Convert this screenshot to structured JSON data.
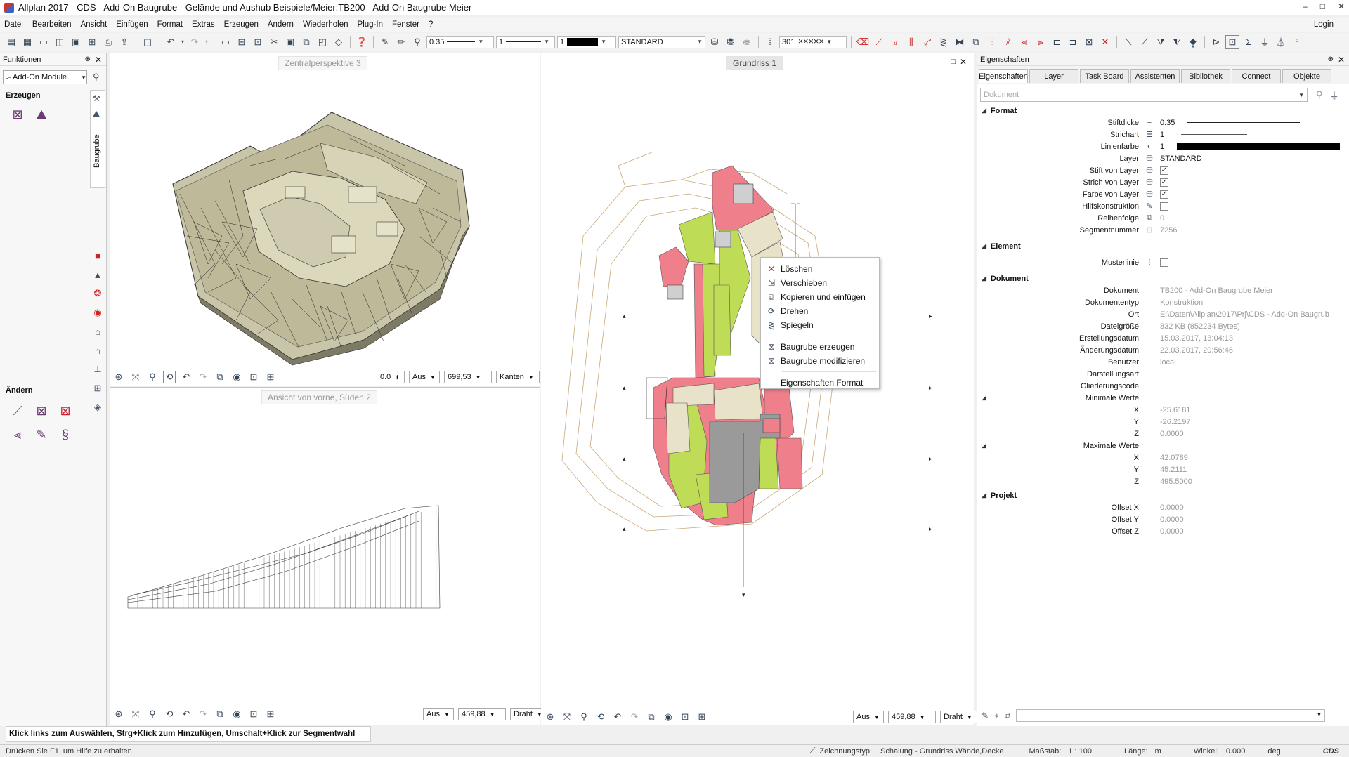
{
  "window": {
    "title": "Allplan 2017 - CDS - Add-On Baugrube - Gelände und Aushub Beispiele/Meier:TB200 - Add-On Baugrube Meier",
    "controls": [
      "–",
      "□",
      "✕"
    ]
  },
  "menu": {
    "items": [
      "Datei",
      "Bearbeiten",
      "Ansicht",
      "Einfügen",
      "Format",
      "Extras",
      "Erzeugen",
      "Ändern",
      "Wiederholen",
      "Plug-In",
      "Fenster",
      "?"
    ],
    "login": "Login"
  },
  "toolbar": {
    "pen_thickness": "0.35",
    "line_type": "1",
    "line_color": "1",
    "layer": "STANDARD",
    "pattern": "301"
  },
  "left_panel": {
    "title": "Funktionen",
    "module": "Add-On Module",
    "tab_label": "Baugrube",
    "section_create": "Erzeugen",
    "section_modify": "Ändern"
  },
  "viewports": {
    "top_left": {
      "label": "Zentralperspektive 3",
      "angle": "0.0",
      "mode": "Aus",
      "scale": "699,53",
      "render": "Kanten"
    },
    "bottom_left": {
      "label": "Ansicht von vorne, Süden 2",
      "mode": "Aus",
      "scale": "459,88",
      "render": "Draht"
    },
    "right": {
      "label": "Grundriss 1",
      "mode": "Aus",
      "scale": "459,88",
      "render": "Draht"
    }
  },
  "context_menu": {
    "items": [
      {
        "label": "Löschen",
        "icon": "delete-icon"
      },
      {
        "label": "Verschieben",
        "icon": "move-icon"
      },
      {
        "label": "Kopieren und einfügen",
        "icon": "copy-paste-icon"
      },
      {
        "label": "Drehen",
        "icon": "rotate-icon"
      },
      {
        "label": "Spiegeln",
        "icon": "mirror-icon"
      },
      {
        "label": "Baugrube erzeugen",
        "icon": "pit-create-icon"
      },
      {
        "label": "Baugrube modifizieren",
        "icon": "pit-modify-icon"
      },
      {
        "label": "Eigenschaften Format",
        "icon": ""
      }
    ]
  },
  "properties": {
    "title": "Eigenschaften",
    "tabs": [
      "Eigenschaften",
      "Layer",
      "Task Board",
      "Assistenten",
      "Bibliothek",
      "Connect",
      "Objekte"
    ],
    "search_placeholder": "Dokument",
    "sections": {
      "format": "Format",
      "element": "Element",
      "document": "Dokument",
      "project": "Projekt"
    },
    "format": {
      "stiftdicke_label": "Stiftdicke",
      "stiftdicke": "0.35",
      "strichart_label": "Strichart",
      "strichart": "1",
      "linienfarbe_label": "Linienfarbe",
      "linienfarbe": "1",
      "layer_label": "Layer",
      "layer": "STANDARD",
      "stift_von_layer": "Stift von Layer",
      "strich_von_layer": "Strich von Layer",
      "farbe_von_layer": "Farbe von Layer",
      "hilfskonstruktion": "Hilfskonstruktion",
      "reihenfolge_label": "Reihenfolge",
      "reihenfolge": "0",
      "segmentnummer_label": "Segmentnummer",
      "segmentnummer": "7256"
    },
    "element": {
      "musterlinie": "Musterlinie"
    },
    "document": {
      "dokument_label": "Dokument",
      "dokument": "TB200 - Add-On Baugrube Meier",
      "dokumenttyp_label": "Dokumententyp",
      "dokumenttyp": "Konstruktion",
      "ort_label": "Ort",
      "ort": "E:\\Daten\\Allplan\\2017\\Prj\\CDS - Add-On Baugrub",
      "dateigroesse_label": "Dateigröße",
      "dateigroesse": "832 KB (852234 Bytes)",
      "erstellungsdatum_label": "Erstellungsdatum",
      "erstellungsdatum": "15.03.2017, 13:04:13",
      "aenderungsdatum_label": "Änderungsdatum",
      "aenderungsdatum": "22.03.2017, 20:56:46",
      "benutzer_label": "Benutzer",
      "benutzer": "local",
      "darstellungsart_label": "Darstellungsart",
      "gliederungscode_label": "Gliederungscode",
      "min_label": "Minimale Werte",
      "min_x": "-25.6181",
      "min_y": "-26.2197",
      "min_z": "0.0000",
      "max_label": "Maximale Werte",
      "max_x": "42.0789",
      "max_y": "45.2111",
      "max_z": "495.5000"
    },
    "project": {
      "offset_x_label": "Offset X",
      "offset_x": "0.0000",
      "offset_y_label": "Offset Y",
      "offset_y": "0.0000",
      "offset_z_label": "Offset Z",
      "offset_z": "0.0000"
    },
    "x": "X",
    "y": "Y",
    "z": "Z"
  },
  "prompt": "Klick links zum Auswählen, Strg+Klick zum Hinzufügen, Umschalt+Klick zur Segmentwahl",
  "status": {
    "help": "Drücken Sie F1, um Hilfe zu erhalten.",
    "drawing_type_label": "Zeichnungstyp:",
    "drawing_type": "Schalung - Grundriss Wände,Decke",
    "scale_label": "Maßstab:",
    "scale": "1 : 100",
    "length_label": "Länge:",
    "length_unit": "m",
    "angle_label": "Winkel:",
    "angle": "0.000",
    "angle_unit": "deg",
    "logo": "CDS"
  },
  "colors": {
    "pit_red": "#ef7f8a",
    "slope_green": "#bedc55",
    "floor_beige": "#e8e3c8",
    "building_grey": "#9a9a9a",
    "terrain_contour": "#c8a878",
    "terrain_3d": "#c9c5a9"
  }
}
